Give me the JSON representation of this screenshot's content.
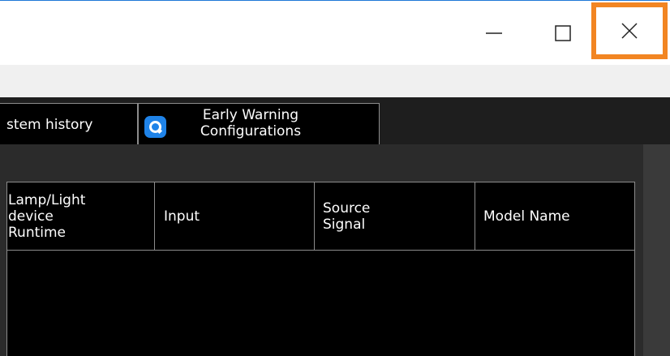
{
  "window": {
    "minimize_glyph": "—",
    "maximize_glyph": "☐",
    "close_glyph": "✕",
    "highlight_color": "#f28522"
  },
  "tabs": [
    {
      "label": "stem history"
    },
    {
      "label": "Early Warning\nConfigurations",
      "icon": "search-icon"
    }
  ],
  "table": {
    "columns": [
      "Lamp/Light\ndevice\nRuntime",
      "Input",
      "Source\nSignal",
      "Model Name"
    ]
  }
}
